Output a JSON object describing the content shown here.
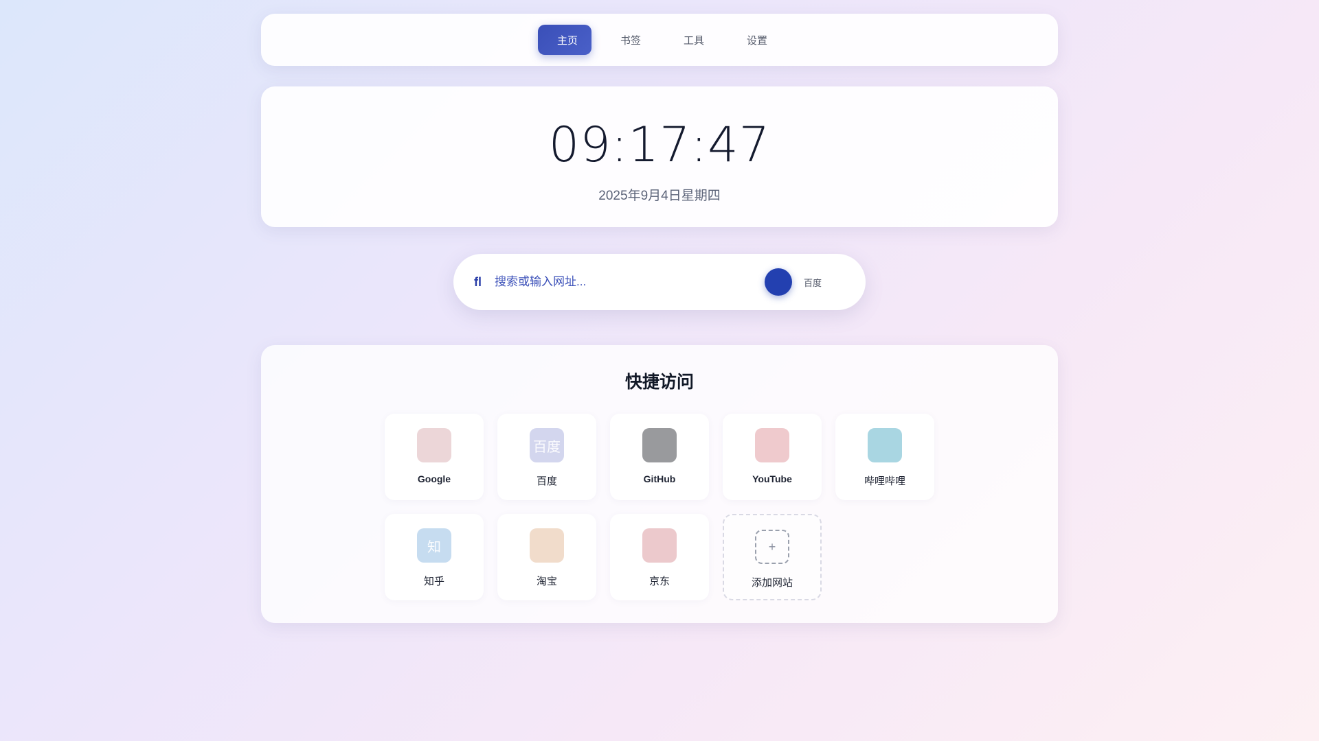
{
  "nav": {
    "items": [
      {
        "label": "主页",
        "icon": "home-icon",
        "active": true
      },
      {
        "label": "书签",
        "icon": "bookmark-icon",
        "active": false
      },
      {
        "label": "工具",
        "icon": "tools-icon",
        "active": false
      },
      {
        "label": "设置",
        "icon": "gear-icon",
        "active": false
      }
    ]
  },
  "clock": {
    "time": "09:17:47",
    "date": "2025年9月4日星期四"
  },
  "search": {
    "placeholder": "搜索或输入网址...",
    "engine": "百度"
  },
  "quick": {
    "title": "快捷访问",
    "sites": [
      {
        "label": "Google",
        "icon": "google-icon",
        "glyph": "",
        "color": "#ecd6d8"
      },
      {
        "label": "百度",
        "icon": "baidu-icon",
        "glyph": "百度",
        "color": "#d3d6ee"
      },
      {
        "label": "GitHub",
        "icon": "github-icon",
        "glyph": "",
        "color": "#999a9d"
      },
      {
        "label": "YouTube",
        "icon": "youtube-icon",
        "glyph": "",
        "color": "#efcacd"
      },
      {
        "label": "哔哩哔哩",
        "icon": "bilibili-icon",
        "glyph": "",
        "color": "#a9d6e2"
      },
      {
        "label": "知乎",
        "icon": "zhihu-icon",
        "glyph": "知",
        "color": "#c6dcf0"
      },
      {
        "label": "淘宝",
        "icon": "taobao-icon",
        "glyph": "",
        "color": "#f1dccb"
      },
      {
        "label": "京东",
        "icon": "jd-icon",
        "glyph": "",
        "color": "#ecc9cc"
      }
    ],
    "add_label": "添加网站",
    "add_glyph": "+"
  }
}
